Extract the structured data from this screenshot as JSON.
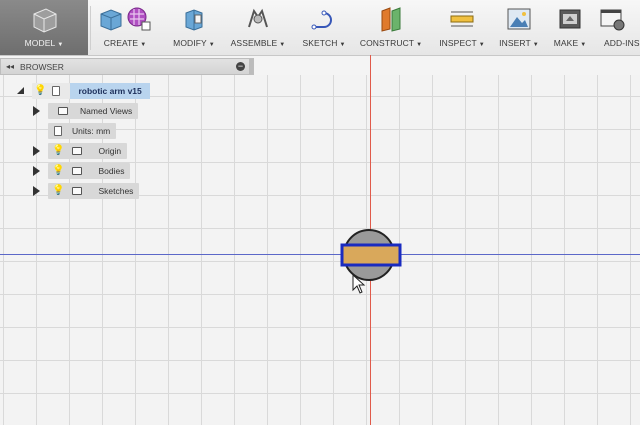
{
  "toolbar": {
    "model": "MODEL",
    "create": "CREATE",
    "modify": "MODIFY",
    "assemble": "ASSEMBLE",
    "sketch": "SKETCH",
    "construct": "CONSTRUCT",
    "inspect": "INSPECT",
    "insert": "INSERT",
    "make": "MAKE",
    "addins": "ADD-INS"
  },
  "browser": {
    "title": "BROWSER",
    "root_label": "robotic arm v15",
    "items": [
      {
        "label": "Named Views"
      },
      {
        "label": "Units: mm"
      },
      {
        "label": "Origin"
      },
      {
        "label": "Bodies"
      },
      {
        "label": "Sketches"
      }
    ]
  },
  "colors": {
    "x_axis": "#e05a4a",
    "y_axis": "#5b67c8",
    "selection": "#1a2bc0",
    "body_fill": "#d9a85b",
    "circle_fill": "#9a9a9a"
  }
}
